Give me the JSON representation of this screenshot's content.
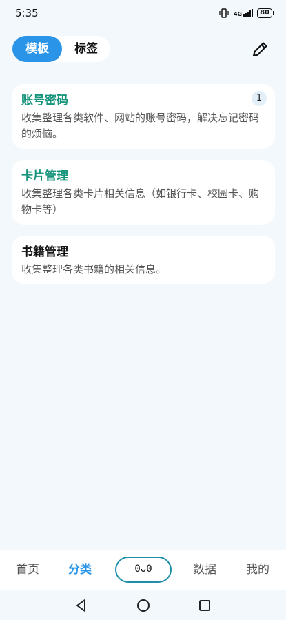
{
  "status_bar": {
    "time": "5:35",
    "network": "4G",
    "battery": "80"
  },
  "header": {
    "tabs": [
      {
        "label": "模板",
        "active": true
      },
      {
        "label": "标签",
        "active": false
      }
    ],
    "edit_icon": "pencil-icon"
  },
  "cards": [
    {
      "title": "账号密码",
      "description": "收集整理各类软件、网站的账号密码，解决忘记密码的烦恼。",
      "badge": "1",
      "title_color": "#17947c"
    },
    {
      "title": "卡片管理",
      "description": "收集整理各类卡片相关信息（如银行卡、校园卡、购物卡等）",
      "title_color": "#17947c"
    },
    {
      "title": "书籍管理",
      "description": "收集整理各类书籍的相关信息。",
      "title_color": "#111111"
    }
  ],
  "bottom_nav": {
    "items": [
      {
        "label": "首页"
      },
      {
        "label": "分类",
        "active": true
      },
      {
        "label": "0ᴗ0"
      },
      {
        "label": "数据"
      },
      {
        "label": "我的"
      }
    ]
  },
  "system_nav": {
    "back": "back-triangle-icon",
    "home": "home-circle-icon",
    "recents": "recents-square-icon"
  },
  "colors": {
    "accent": "#2a95e8",
    "teal": "#17947c",
    "background": "#f2f8fc"
  }
}
